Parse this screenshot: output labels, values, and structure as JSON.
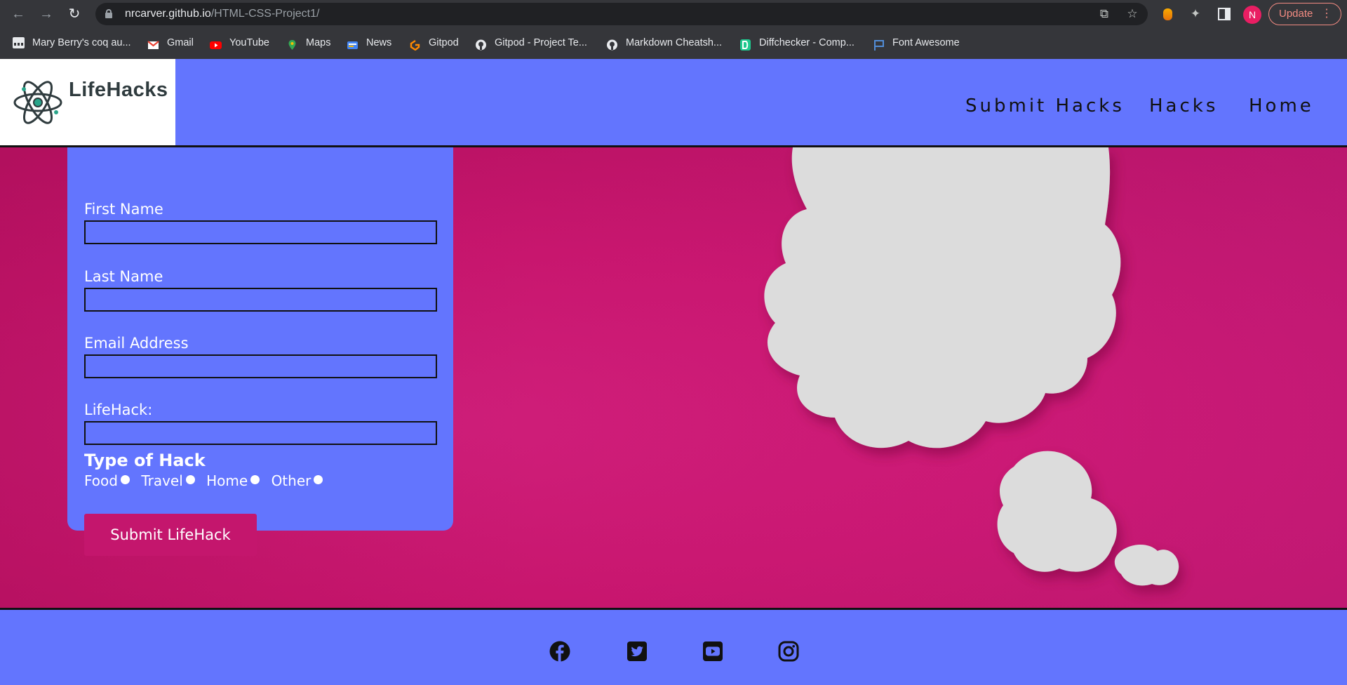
{
  "browser": {
    "url_domain": "nrcarver.github.io",
    "url_path": "/HTML-CSS-Project1/",
    "update_label": "Update",
    "avatar_initial": "N",
    "bookmarks": [
      {
        "label": "Mary Berry's coq au...",
        "icon": "page-icon",
        "color": "#e8eaed"
      },
      {
        "label": "Gmail",
        "icon": "gmail-icon",
        "color": "#ea4335"
      },
      {
        "label": "YouTube",
        "icon": "youtube-icon",
        "color": "#ff0000"
      },
      {
        "label": "Maps",
        "icon": "maps-icon",
        "color": "#34a853"
      },
      {
        "label": "News",
        "icon": "news-icon",
        "color": "#4285f4"
      },
      {
        "label": "Gitpod",
        "icon": "gitpod-icon",
        "color": "#ff8a00"
      },
      {
        "label": "Gitpod - Project Te...",
        "icon": "github-icon",
        "color": "#e8eaed"
      },
      {
        "label": "Markdown Cheatsh...",
        "icon": "github-icon",
        "color": "#e8eaed"
      },
      {
        "label": "Diffchecker - Comp...",
        "icon": "diffchecker-icon",
        "color": "#1ec98f"
      },
      {
        "label": "Font Awesome",
        "icon": "flag-icon",
        "color": "#528dd7"
      }
    ]
  },
  "site": {
    "logo_text": "LifeHacks",
    "nav": {
      "submit": "Submit Hacks",
      "hacks": "Hacks",
      "home": "Home"
    },
    "accent": "#6375fe",
    "hero_color": "#c8166e"
  },
  "form": {
    "fields": [
      {
        "label": "First Name",
        "value": ""
      },
      {
        "label": "Last Name",
        "value": ""
      },
      {
        "label": "Email Address",
        "value": ""
      },
      {
        "label": "LifeHack:",
        "value": ""
      }
    ],
    "type_title": "Type of Hack",
    "options": [
      "Food",
      "Travel",
      "Home",
      "Other"
    ],
    "submit_label": "Submit LifeHack"
  },
  "footer": {
    "icons": [
      "facebook-icon",
      "twitter-icon",
      "youtube-icon",
      "instagram-icon"
    ]
  }
}
